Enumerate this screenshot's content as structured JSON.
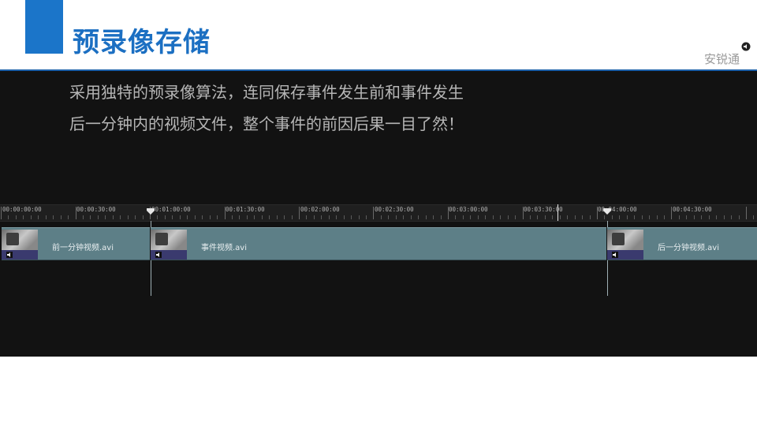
{
  "header": {
    "title": "预录像存储",
    "brand": "安锐通"
  },
  "description": {
    "line1": "采用独特的预录像算法，连同保存事件发生前和事件发生",
    "line2": "后一分钟内的视频文件，整个事件的前因后果一目了然！"
  },
  "timeline": {
    "ticks": [
      "00:00:00:00",
      "00:00:30:00",
      "00:01:00:00",
      "00:01:30:00",
      "00:02:00:00",
      "00:02:30:00",
      "00:03:00:00",
      "00:03:30:00",
      "00:04:00:00",
      "00:04:30:00"
    ],
    "clips": [
      {
        "label": "前一分钟视频.avi"
      },
      {
        "label": "事件视频.avi"
      },
      {
        "label": "后一分钟视频.avi"
      }
    ]
  },
  "colors": {
    "accent": "#1b75c9",
    "title": "#1b6fc2",
    "panel": "#121212",
    "track": "#5d7f87"
  },
  "icons": [
    "speaker-icon",
    "marker-icon",
    "video-thumbnail"
  ]
}
